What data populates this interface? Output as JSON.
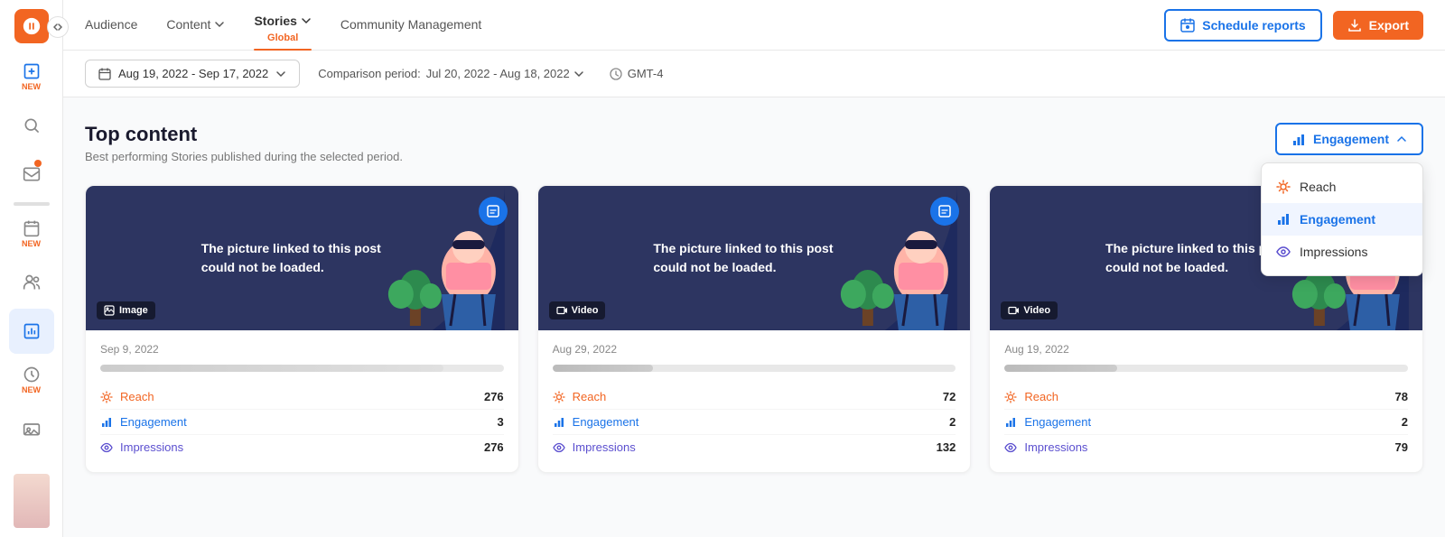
{
  "sidebar": {
    "logo_alt": "Agorapulse logo",
    "items": [
      {
        "id": "compose",
        "label": "NEW",
        "icon": "compose-icon",
        "active": false
      },
      {
        "id": "search",
        "label": "",
        "icon": "search-icon",
        "active": false
      },
      {
        "id": "inbox",
        "label": "",
        "icon": "inbox-icon",
        "active": false
      },
      {
        "id": "calendar",
        "label": "NEW",
        "icon": "calendar-icon",
        "active": false
      },
      {
        "id": "audience",
        "label": "",
        "icon": "audience-icon",
        "active": false
      },
      {
        "id": "reports",
        "label": "",
        "icon": "reports-icon",
        "active": true
      },
      {
        "id": "dashboard",
        "label": "NEW",
        "icon": "dashboard-icon",
        "active": false
      },
      {
        "id": "media",
        "label": "",
        "icon": "media-icon",
        "active": false
      }
    ]
  },
  "nav": {
    "items": [
      {
        "id": "audience",
        "label": "Audience",
        "active": false,
        "has_dropdown": false
      },
      {
        "id": "content",
        "label": "Content",
        "active": false,
        "has_dropdown": true
      },
      {
        "id": "stories",
        "label": "Stories",
        "active": true,
        "has_dropdown": true,
        "sub": "Global"
      },
      {
        "id": "community",
        "label": "Community Management",
        "active": false,
        "has_dropdown": false
      }
    ],
    "schedule_btn": "Schedule reports",
    "export_btn": "Export"
  },
  "filters": {
    "date_range": "Aug 19, 2022 - Sep 17, 2022",
    "comparison_label": "Comparison period:",
    "comparison_range": "Jul 20, 2022 - Aug 18, 2022",
    "timezone": "GMT-4"
  },
  "top_content": {
    "title": "Top content",
    "subtitle": "Best performing Stories published during the selected period.",
    "engagement_btn": "Engagement",
    "dropdown_open": true,
    "dropdown_items": [
      {
        "id": "reach",
        "label": "Reach",
        "selected": false
      },
      {
        "id": "engagement",
        "label": "Engagement",
        "selected": true
      },
      {
        "id": "impressions",
        "label": "Impressions",
        "selected": false
      }
    ],
    "cards": [
      {
        "id": "card1",
        "image_text": "The picture linked to this post could not be loaded.",
        "type": "Image",
        "date": "Sep 9, 2022",
        "metrics_fill_width": "85%",
        "metrics": [
          {
            "id": "reach",
            "label": "Reach",
            "value": "276"
          },
          {
            "id": "engagement",
            "label": "Engagement",
            "value": "3"
          },
          {
            "id": "impressions",
            "label": "Impressions",
            "value": "276"
          }
        ]
      },
      {
        "id": "card2",
        "image_text": "The picture linked to this post could not be loaded.",
        "type": "Video",
        "date": "Aug 29, 2022",
        "metrics_fill_width": "25%",
        "metrics": [
          {
            "id": "reach",
            "label": "Reach",
            "value": "72"
          },
          {
            "id": "engagement",
            "label": "Engagement",
            "value": "2"
          },
          {
            "id": "impressions",
            "label": "Impressions",
            "value": "132"
          }
        ]
      },
      {
        "id": "card3",
        "image_text": "The picture linked to this post could not be loaded.",
        "type": "Video",
        "date": "Aug 19, 2022",
        "metrics_fill_width": "28%",
        "metrics": [
          {
            "id": "reach",
            "label": "Reach",
            "value": "78"
          },
          {
            "id": "engagement",
            "label": "Engagement",
            "value": "2"
          },
          {
            "id": "impressions",
            "label": "Impressions",
            "value": "79"
          }
        ]
      }
    ]
  }
}
